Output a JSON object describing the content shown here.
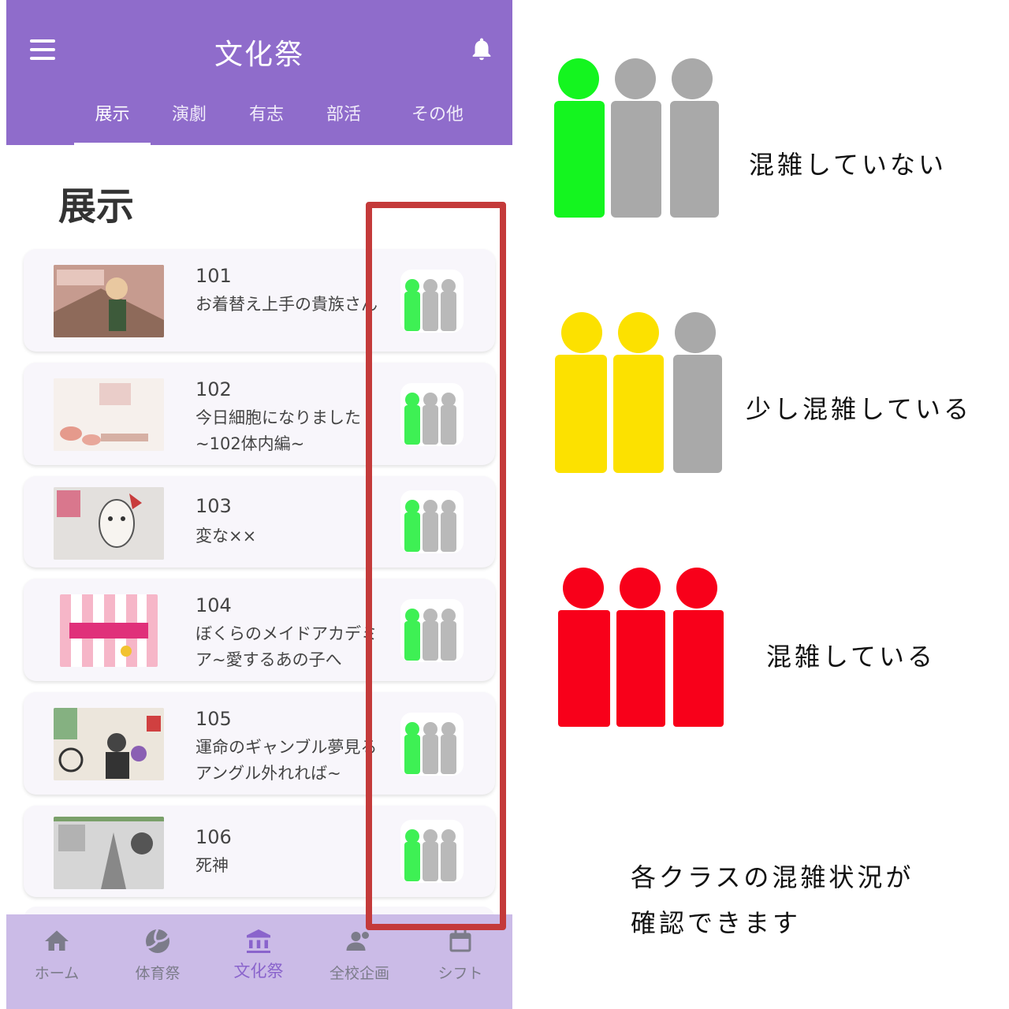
{
  "app": {
    "title": "文化祭",
    "tabs": [
      {
        "label": "展示",
        "active": true
      },
      {
        "label": "演劇",
        "active": false
      },
      {
        "label": "有志",
        "active": false
      },
      {
        "label": "部活",
        "active": false
      },
      {
        "label": "その他",
        "active": false
      }
    ]
  },
  "section_title": "展示",
  "exhibits": [
    {
      "number": "101",
      "name": "お着替え上手の貴族さん",
      "crowd": "low"
    },
    {
      "number": "102",
      "name": "今日細胞になりました~102体内編~",
      "crowd": "low"
    },
    {
      "number": "103",
      "name": "変な××",
      "crowd": "low"
    },
    {
      "number": "104",
      "name": "ぼくらのメイドアカデミア~愛するあの子へ",
      "crowd": "low"
    },
    {
      "number": "105",
      "name": "運命のギャンブル夢見るアングル外れれば~",
      "crowd": "low"
    },
    {
      "number": "106",
      "name": "死神",
      "crowd": "low"
    }
  ],
  "bottom_nav": [
    {
      "label": "ホーム",
      "icon": "home-icon",
      "active": false
    },
    {
      "label": "体育祭",
      "icon": "volleyball-icon",
      "active": false
    },
    {
      "label": "文化祭",
      "icon": "museum-icon",
      "active": true
    },
    {
      "label": "全校企画",
      "icon": "people-icon",
      "active": false
    },
    {
      "label": "シフト",
      "icon": "calendar-icon",
      "active": false
    }
  ],
  "legend": {
    "levels": [
      {
        "label": "混雑していない",
        "colors": [
          "#14f51f",
          "#a9a9a9",
          "#a9a9a9"
        ]
      },
      {
        "label": "少し混雑している",
        "colors": [
          "#fce100",
          "#fce100",
          "#a9a9a9"
        ]
      },
      {
        "label": "混雑している",
        "colors": [
          "#f8001a",
          "#f8001a",
          "#f8001a"
        ]
      }
    ],
    "note_line1": "各クラスの混雑状況が",
    "note_line2": "確認できます"
  },
  "colors": {
    "accent": "#8f6ccb",
    "nav_background": "#cbbbe7",
    "crowd_low": "#3ef054",
    "crowd_idle": "#b9b9b9",
    "highlight_frame": "#c43a3a"
  }
}
